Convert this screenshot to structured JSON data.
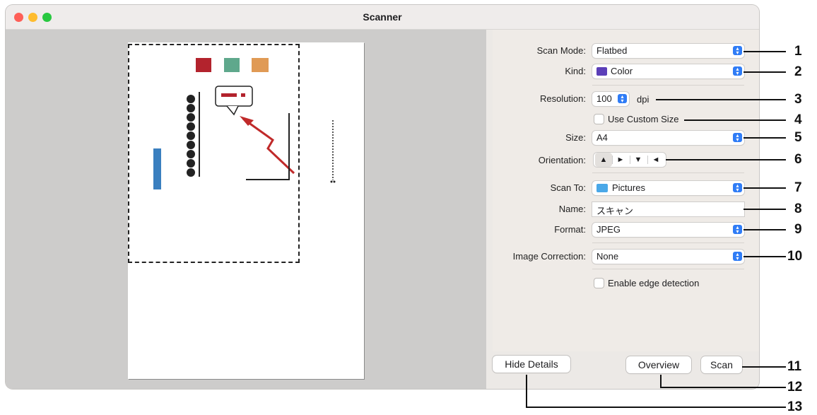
{
  "window": {
    "title": "Scanner"
  },
  "settings": {
    "scan_mode": {
      "label": "Scan Mode:",
      "value": "Flatbed"
    },
    "kind": {
      "label": "Kind:",
      "value": "Color"
    },
    "resolution": {
      "label": "Resolution:",
      "value": "100",
      "unit": "dpi"
    },
    "custom_size": {
      "label": "Use Custom Size",
      "checked": false
    },
    "size": {
      "label": "Size:",
      "value": "A4"
    },
    "orientation": {
      "label": "Orientation:",
      "options_icons": [
        "portrait-icon",
        "landscape-left-icon",
        "upside-down-icon",
        "landscape-right-icon"
      ],
      "selected": 0
    },
    "scan_to": {
      "label": "Scan To:",
      "value": "Pictures"
    },
    "name": {
      "label": "Name:",
      "value": "スキャン"
    },
    "format": {
      "label": "Format:",
      "value": "JPEG"
    },
    "image_correction": {
      "label": "Image Correction:",
      "value": "None"
    },
    "edge_detection": {
      "label": "Enable edge detection",
      "checked": false
    }
  },
  "buttons": {
    "hide_details": "Hide Details",
    "overview": "Overview",
    "scan": "Scan"
  },
  "callouts": [
    "1",
    "2",
    "3",
    "4",
    "5",
    "6",
    "7",
    "8",
    "9",
    "10",
    "11",
    "12",
    "13"
  ],
  "colors": {
    "accent": "#2f7cf6",
    "folder": "#4aa8e8"
  }
}
